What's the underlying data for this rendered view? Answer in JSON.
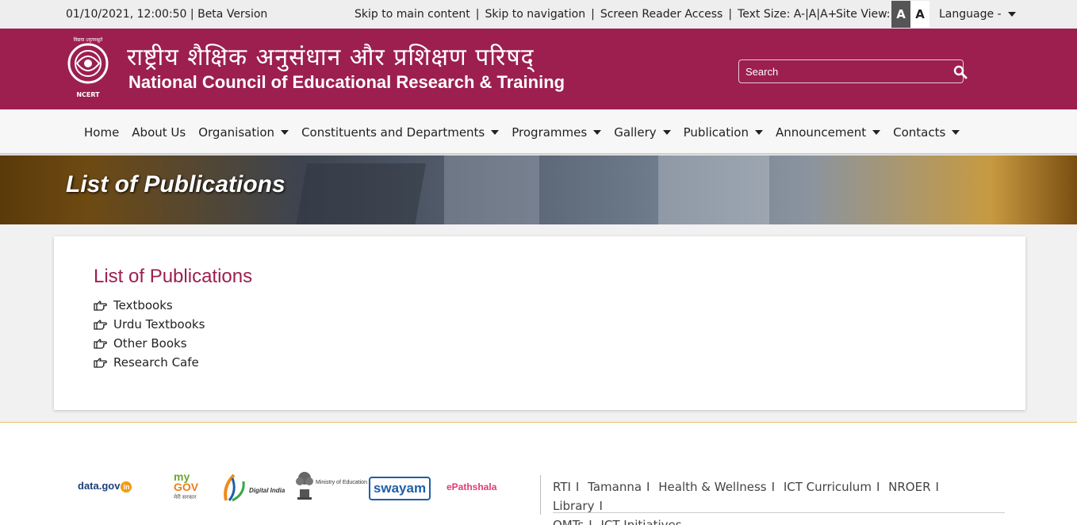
{
  "topbar": {
    "datetime": "01/10/2021, 12:00:50 | Beta Version",
    "skip_main": "Skip to main content",
    "skip_nav": "Skip to navigation",
    "screen_reader": "Screen Reader Access",
    "text_size": "Text Size: A-|A|A+",
    "site_view_label": "Site View:",
    "site_view_dark": "A",
    "site_view_light": "A",
    "language": "Language -"
  },
  "header": {
    "logo_text_top": "विद्यया ऽमृतमश्नुते",
    "logo_text_bottom": "NCERT",
    "title_hindi": "राष्ट्रीय शैक्षिक अनुसंधान और प्रशिक्षण परिषद्",
    "title_english": "National Council of Educational Research & Training",
    "search_placeholder": "Search"
  },
  "nav": {
    "items": [
      {
        "label": "Home"
      },
      {
        "label": "About Us"
      },
      {
        "label": "Organisation"
      },
      {
        "label": "Constituents and Departments"
      },
      {
        "label": "Programmes"
      },
      {
        "label": "Gallery"
      },
      {
        "label": "Publication"
      },
      {
        "label": "Announcement"
      },
      {
        "label": "Contacts"
      }
    ]
  },
  "banner": {
    "title": "List of Publications"
  },
  "main": {
    "heading": "List of Publications",
    "items": [
      "Textbooks",
      "Urdu Textbooks",
      "Other Books",
      "Research Cafe"
    ]
  },
  "footer": {
    "logos": {
      "datagov": "data.gov",
      "datagov_suffix": "in",
      "mygov_my": "my",
      "mygov_gov": "GOV",
      "mygov_sub": "मेरी सरकार",
      "digital_india": "Digital India",
      "moe": "Ministry of Education",
      "swayam": "swayam",
      "epathshala": "ePathshala"
    },
    "links_row1": [
      "RTI",
      "Tamanna",
      "Health & Wellness",
      "ICT Curriculum",
      "NROER",
      "Library"
    ],
    "links_row2": [
      "QMTs",
      "ICT Initiatives"
    ],
    "separator": "I"
  }
}
